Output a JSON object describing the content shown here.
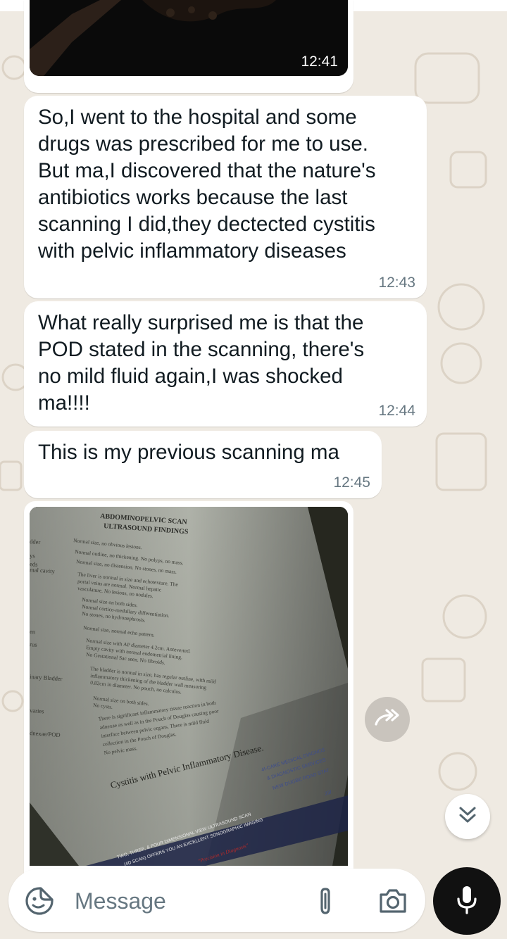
{
  "messages": [
    {
      "text": "So,I went to the hospital and some\ndrugs was prescribed for me to use.\nBut ma,I discovered that the nature's\nantibiotics works because the last\nscanning I did,they dectected cystitis\nwith pelvic inflammatory diseases",
      "time": "12:43"
    },
    {
      "text": "What really surprised me is that the\nPOD stated in the scanning, there's\nno mild fluid again,I was shocked\nma!!!!",
      "time": "12:44"
    },
    {
      "text": "This is my previous scanning ma",
      "time": "12:45"
    }
  ],
  "media": {
    "top_photo_time": "12:41",
    "scan_doc": {
      "header_1": "ABDOMINOPELVIC SCAN",
      "header_2": "ULTRASOUND FINDINGS",
      "labels": [
        "dder",
        "ys",
        "eds",
        "mal cavity",
        "en",
        "rus",
        "inary Bladder",
        "varies",
        "dnexae/POD"
      ],
      "lines": [
        "Normal size, no obvious lesions.",
        "Normal outline, no thickening. No polyps, no mass.",
        "Normal size, no distension. No stones, no mass.",
        "The liver is normal in size and echotexture. The",
        "portal veins are normal. Normal hepatic",
        "vasculature. No lesions, no nodules.",
        "Normal size on both sides.",
        "Normal cortico-medullary differentiation.",
        "No stones, no hydronephrosis.",
        "Normal size, normal echo pattern.",
        "Normal size with AP diameter 4.2cm. Anteverted.",
        "Empty cavity with normal endometrial lining.",
        "No Gestational Sac seen. No fibroids.",
        "The bladder is normal in size, has regular outline, with mild",
        "inflammatory thickening of the bladder wall measuring",
        "0.82cm in diameter. No pouch, no calculus.",
        "Normal size on both sides.",
        "No cysts.",
        "There is significant inflammatory tissue reaction in both",
        "adnexae as well as in the Pouch of Douglas causing poor",
        "interface between pelvic organs. There is mild fluid",
        "collection in the Pouch of Douglas.",
        "No pelvic mass."
      ],
      "impression": "Cystitis with Pelvic Inflammatory Disease.",
      "stamp_lines": [
        "4I-CARE MEDICAL DIAGNOS",
        "& DIAGNOSTIC SERVICES",
        "NEW DUGBE ROAD STAT",
        "23/"
      ],
      "footer_1": "TWO, THREE, & FOUR DIMENSIONAL VIEW ULTRASOUND SCAN",
      "footer_2": "(4D SCAN) OFFERS YOU AN EXCELLENT SONOGRAPHIC IMAGING",
      "footer_3": "\"Precision in Diagnosis\""
    }
  },
  "composer": {
    "placeholder": "Message"
  },
  "icons": {
    "sticker": "sticker-icon",
    "attach": "paperclip-icon",
    "camera": "camera-icon",
    "mic": "microphone-icon",
    "forward": "forward-icon",
    "scroll": "double-chevron-down-icon"
  },
  "colors": {
    "wallpaper": "#efeae2",
    "bubble": "#ffffff",
    "text": "#111b21",
    "time": "#667781",
    "mic_button": "#111111"
  }
}
